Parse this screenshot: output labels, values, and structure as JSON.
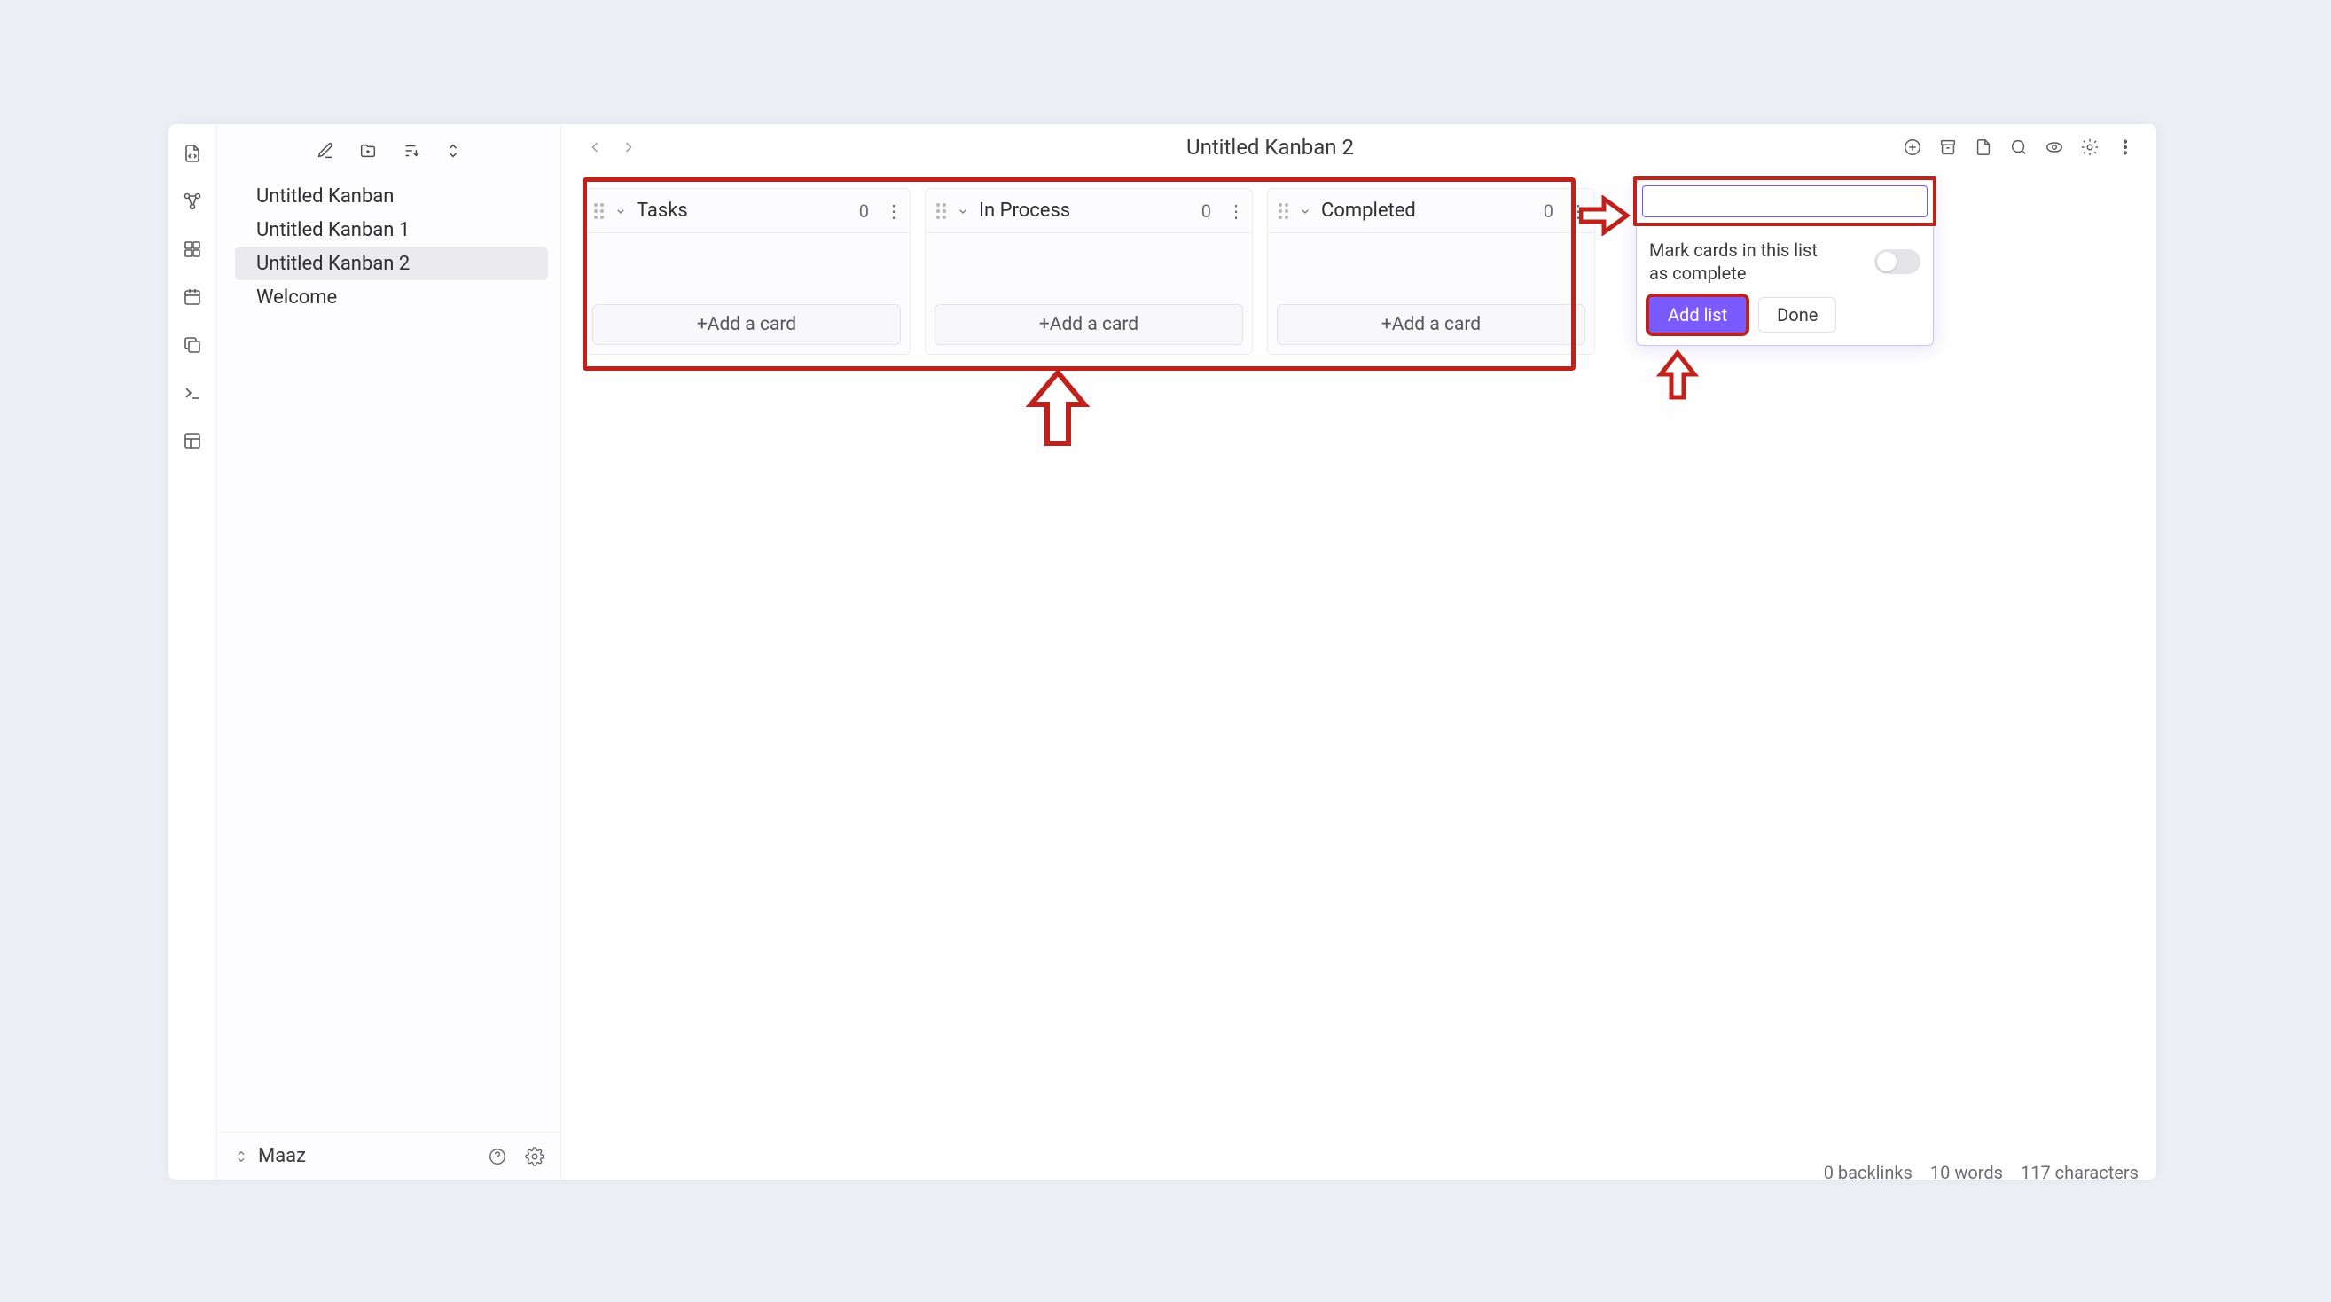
{
  "sidebar": {
    "items": [
      {
        "label": "Untitled Kanban"
      },
      {
        "label": "Untitled Kanban 1"
      },
      {
        "label": "Untitled Kanban 2",
        "active": true
      },
      {
        "label": "Welcome"
      }
    ],
    "user": "Maaz"
  },
  "doc_title": "Untitled Kanban 2",
  "columns": [
    {
      "title": "Tasks",
      "count": "0",
      "add": "+Add a card"
    },
    {
      "title": "In Process",
      "count": "0",
      "add": "+Add a card"
    },
    {
      "title": "Completed",
      "count": "0",
      "add": "+Add a card"
    }
  ],
  "new_list": {
    "placeholder": "",
    "mark_label": "Mark cards in this list as complete",
    "add_btn": "Add list",
    "done_btn": "Done"
  },
  "status": {
    "backlinks": "0 backlinks",
    "words": "10 words",
    "chars": "117 characters"
  }
}
